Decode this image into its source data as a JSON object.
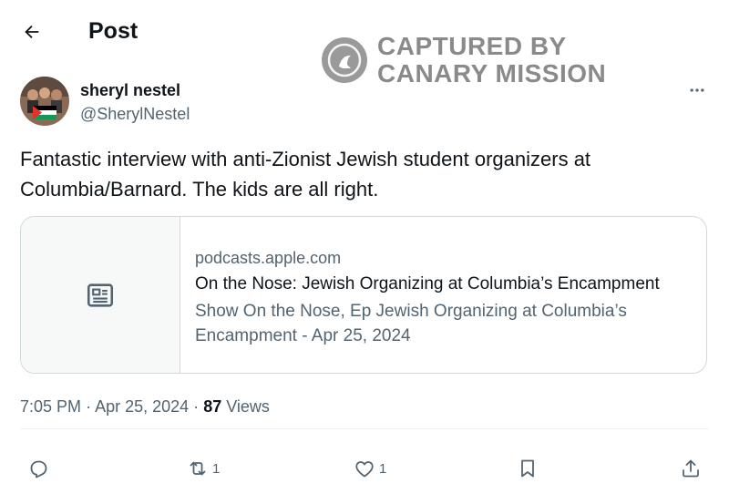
{
  "header": {
    "title": "Post",
    "back_icon": "arrow-left-icon"
  },
  "watermark": {
    "line1": "CAPTURED BY",
    "line2": "CANARY MISSION",
    "color": "#8a8a8a"
  },
  "author": {
    "name": "sheryl nestel",
    "handle": "@SherylNestel"
  },
  "post": {
    "text": "Fantastic interview with anti-Zionist Jewish student organizers at Columbia/Barnard. The kids are all right."
  },
  "link_card": {
    "domain": "podcasts.apple.com",
    "title": "On the Nose: Jewish Organizing at Columbia’s Encampment",
    "description": "Show On the Nose, Ep Jewish Organizing at Columbia’s Encampment - Apr 25, 2024"
  },
  "meta": {
    "time": "7:05 PM",
    "date": "Apr 25, 2024",
    "separator": "·",
    "views_count": "87",
    "views_label": "Views"
  },
  "actions": {
    "reply_count": "",
    "repost_count": "1",
    "like_count": "1",
    "bookmark_count": "",
    "share_count": ""
  },
  "colors": {
    "text": "#0f1419",
    "secondary": "#536471",
    "border": "#cfd9de"
  }
}
